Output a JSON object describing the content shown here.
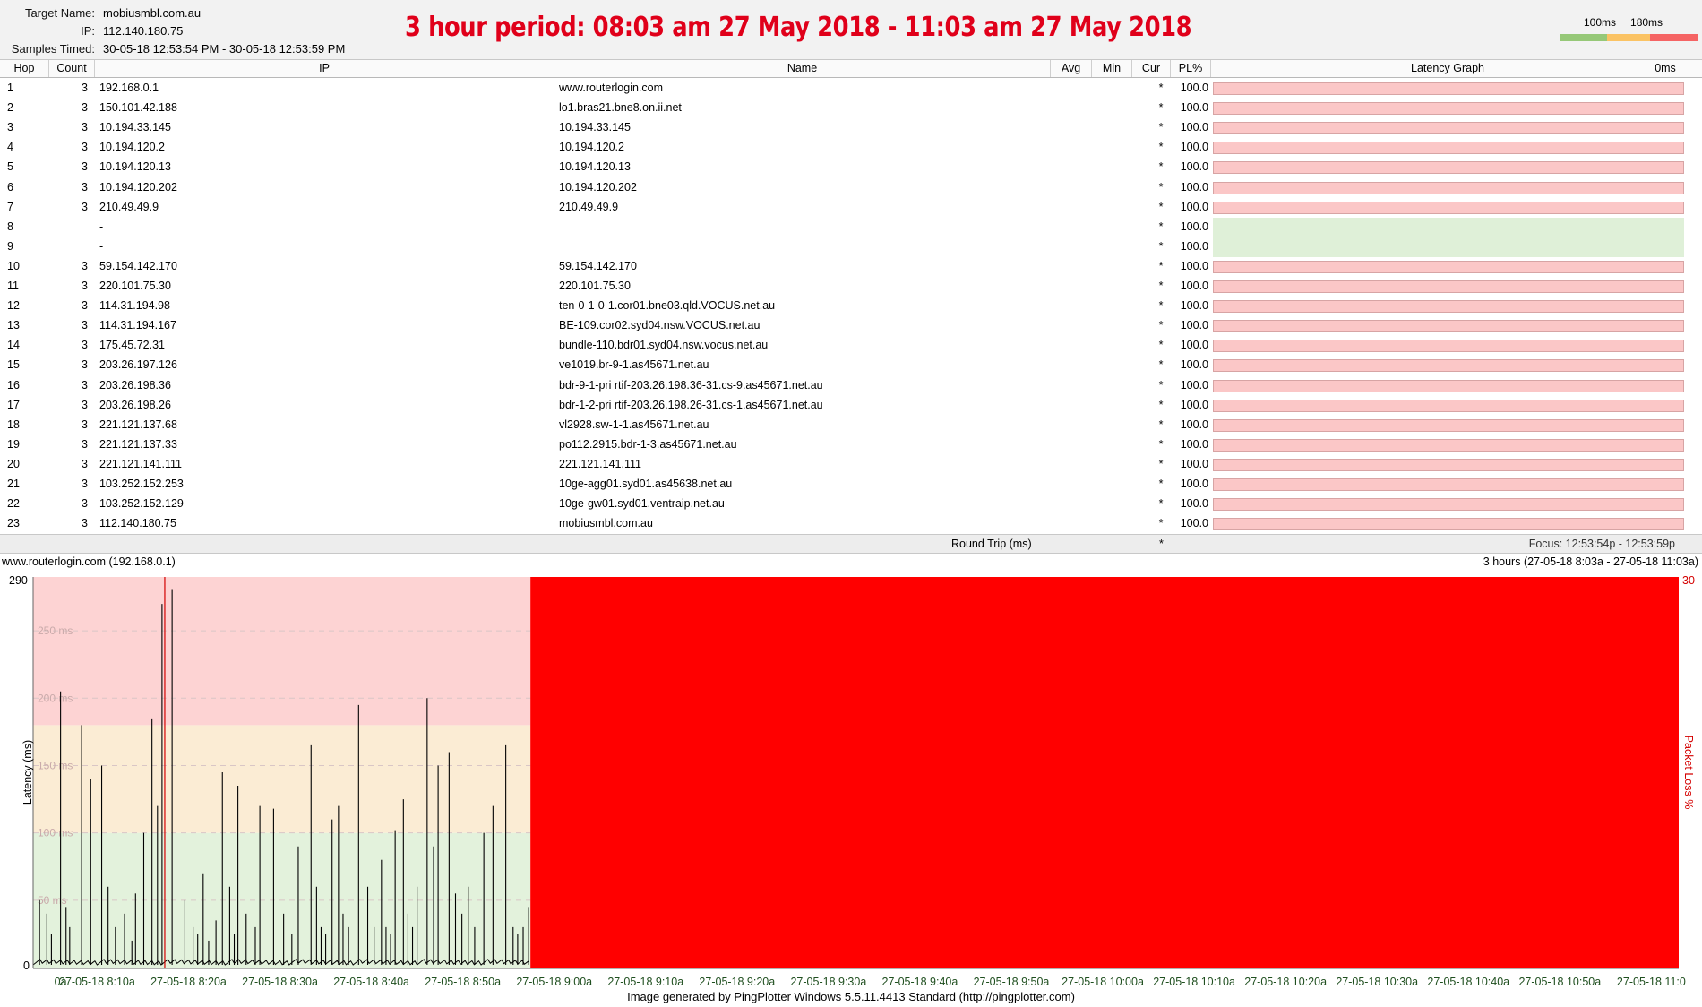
{
  "colors": {
    "accent_red": "#e0001a",
    "loss_fill": "#ff0000",
    "zone_good": "#e3f2dc",
    "zone_warn": "#fbecd4",
    "zone_bad": "#fdd3d3",
    "row_loss": "#fbc7c7",
    "row_empty": "#dff0d8",
    "legend_green": "#96c878",
    "legend_yellow": "#fbc364",
    "legend_red": "#f56464",
    "row_alt_bg": "#ffffff"
  },
  "header": {
    "target_label": "Target Name:",
    "target_value": "mobiusmbl.com.au",
    "ip_label": "IP:",
    "ip_value": "112.140.180.75",
    "samples_label": "Samples Timed:",
    "samples_value": "30-05-18 12:53:54 PM - 30-05-18 12:53:59 PM",
    "period_title": "3 hour period:  08:03 am 27 May 2018 - 11:03 am 27 May 2018",
    "legend_low": "100ms",
    "legend_high": "180ms"
  },
  "table": {
    "columns": [
      "Hop",
      "Count",
      "IP",
      "Name",
      "Avg",
      "Min",
      "Cur",
      "PL%",
      "Latency Graph",
      "0ms"
    ],
    "rows": [
      {
        "hop": "1",
        "count": "3",
        "ip": "192.168.0.1",
        "name": "www.routerlogin.com",
        "cur": "*",
        "pl": "100.0",
        "state": "loss"
      },
      {
        "hop": "2",
        "count": "3",
        "ip": "150.101.42.188",
        "name": "lo1.bras21.bne8.on.ii.net",
        "cur": "*",
        "pl": "100.0",
        "state": "loss"
      },
      {
        "hop": "3",
        "count": "3",
        "ip": "10.194.33.145",
        "name": "10.194.33.145",
        "cur": "*",
        "pl": "100.0",
        "state": "loss"
      },
      {
        "hop": "4",
        "count": "3",
        "ip": "10.194.120.2",
        "name": "10.194.120.2",
        "cur": "*",
        "pl": "100.0",
        "state": "loss"
      },
      {
        "hop": "5",
        "count": "3",
        "ip": "10.194.120.13",
        "name": "10.194.120.13",
        "cur": "*",
        "pl": "100.0",
        "state": "loss"
      },
      {
        "hop": "6",
        "count": "3",
        "ip": "10.194.120.202",
        "name": "10.194.120.202",
        "cur": "*",
        "pl": "100.0",
        "state": "loss"
      },
      {
        "hop": "7",
        "count": "3",
        "ip": "210.49.49.9",
        "name": "210.49.49.9",
        "cur": "*",
        "pl": "100.0",
        "state": "loss"
      },
      {
        "hop": "8",
        "count": "",
        "ip": "-",
        "name": "",
        "cur": "*",
        "pl": "100.0",
        "state": "empty"
      },
      {
        "hop": "9",
        "count": "",
        "ip": "-",
        "name": "",
        "cur": "*",
        "pl": "100.0",
        "state": "empty"
      },
      {
        "hop": "10",
        "count": "3",
        "ip": "59.154.142.170",
        "name": "59.154.142.170",
        "cur": "*",
        "pl": "100.0",
        "state": "loss"
      },
      {
        "hop": "11",
        "count": "3",
        "ip": "220.101.75.30",
        "name": "220.101.75.30",
        "cur": "*",
        "pl": "100.0",
        "state": "loss"
      },
      {
        "hop": "12",
        "count": "3",
        "ip": "114.31.194.98",
        "name": "ten-0-1-0-1.cor01.bne03.qld.VOCUS.net.au",
        "cur": "*",
        "pl": "100.0",
        "state": "loss"
      },
      {
        "hop": "13",
        "count": "3",
        "ip": "114.31.194.167",
        "name": "BE-109.cor02.syd04.nsw.VOCUS.net.au",
        "cur": "*",
        "pl": "100.0",
        "state": "loss"
      },
      {
        "hop": "14",
        "count": "3",
        "ip": "175.45.72.31",
        "name": "bundle-110.bdr01.syd04.nsw.vocus.net.au",
        "cur": "*",
        "pl": "100.0",
        "state": "loss"
      },
      {
        "hop": "15",
        "count": "3",
        "ip": "203.26.197.126",
        "name": "ve1019.br-9-1.as45671.net.au",
        "cur": "*",
        "pl": "100.0",
        "state": "loss"
      },
      {
        "hop": "16",
        "count": "3",
        "ip": "203.26.198.36",
        "name": "bdr-9-1-pri rtif-203.26.198.36-31.cs-9.as45671.net.au",
        "cur": "*",
        "pl": "100.0",
        "state": "loss"
      },
      {
        "hop": "17",
        "count": "3",
        "ip": "203.26.198.26",
        "name": "bdr-1-2-pri rtif-203.26.198.26-31.cs-1.as45671.net.au",
        "cur": "*",
        "pl": "100.0",
        "state": "loss"
      },
      {
        "hop": "18",
        "count": "3",
        "ip": "221.121.137.68",
        "name": "vl2928.sw-1-1.as45671.net.au",
        "cur": "*",
        "pl": "100.0",
        "state": "loss"
      },
      {
        "hop": "19",
        "count": "3",
        "ip": "221.121.137.33",
        "name": "po112.2915.bdr-1-3.as45671.net.au",
        "cur": "*",
        "pl": "100.0",
        "state": "loss"
      },
      {
        "hop": "20",
        "count": "3",
        "ip": "221.121.141.111",
        "name": "221.121.141.111",
        "cur": "*",
        "pl": "100.0",
        "state": "loss"
      },
      {
        "hop": "21",
        "count": "3",
        "ip": "103.252.152.253",
        "name": "10ge-agg01.syd01.as45638.net.au",
        "cur": "*",
        "pl": "100.0",
        "state": "loss"
      },
      {
        "hop": "22",
        "count": "3",
        "ip": "103.252.152.129",
        "name": "10ge-gw01.syd01.ventraip.net.au",
        "cur": "*",
        "pl": "100.0",
        "state": "loss"
      },
      {
        "hop": "23",
        "count": "3",
        "ip": "112.140.180.75",
        "name": "mobiusmbl.com.au",
        "cur": "*",
        "pl": "100.0",
        "state": "loss"
      }
    ],
    "roundtrip_label": "Round Trip (ms)",
    "roundtrip_cur": "*",
    "focus_label": "Focus: 12:53:54p - 12:53:59p"
  },
  "chart": {
    "title": "www.routerlogin.com (192.168.0.1)",
    "range_label": "3 hours (27-05-18 8:03a - 27-05-18 11:03a)"
  },
  "chart_data": {
    "type": "line",
    "ylabel": "Latency (ms)",
    "y2label": "Packet Loss %",
    "ylim": [
      0,
      290
    ],
    "y_top_label": "290",
    "y_bottom_label": "0",
    "y2_top_label": "30",
    "gridlines": [
      "250 ms",
      "200 ms",
      "150 ms",
      "100 ms",
      "50 ms"
    ],
    "gridline_values": [
      250,
      200,
      150,
      100,
      50
    ],
    "zones": [
      {
        "name": "good",
        "from": 0,
        "to": 100
      },
      {
        "name": "warn",
        "from": 100,
        "to": 180
      },
      {
        "name": "bad",
        "from": 180,
        "to": 290
      }
    ],
    "x_range_minutes": [
      0,
      180
    ],
    "x_ticks": [
      "0a",
      "27-05-18 8:10a",
      "27-05-18 8:20a",
      "27-05-18 8:30a",
      "27-05-18 8:40a",
      "27-05-18 8:50a",
      "27-05-18 9:00a",
      "27-05-18 9:10a",
      "27-05-18 9:20a",
      "27-05-18 9:30a",
      "27-05-18 9:40a",
      "27-05-18 9:50a",
      "27-05-18 10:00a",
      "27-05-18 10:10a",
      "27-05-18 10:20a",
      "27-05-18 10:30a",
      "27-05-18 10:40a",
      "27-05-18 10:50a",
      "27-05-18 11:0"
    ],
    "x_tick_minutes": [
      3,
      7,
      17,
      27,
      37,
      47,
      57,
      67,
      77,
      87,
      97,
      107,
      117,
      127,
      137,
      147,
      157,
      167,
      177
    ],
    "loss_start_minute": 54.4,
    "marker_minute": 14.4,
    "spikes": [
      {
        "minute": 0.7,
        "ms": 50
      },
      {
        "minute": 1.5,
        "ms": 40
      },
      {
        "minute": 2.0,
        "ms": 25
      },
      {
        "minute": 3.0,
        "ms": 205
      },
      {
        "minute": 3.6,
        "ms": 45
      },
      {
        "minute": 4.0,
        "ms": 30
      },
      {
        "minute": 5.3,
        "ms": 180
      },
      {
        "minute": 6.3,
        "ms": 140
      },
      {
        "minute": 7.5,
        "ms": 150
      },
      {
        "minute": 8.2,
        "ms": 60
      },
      {
        "minute": 9.0,
        "ms": 30
      },
      {
        "minute": 10.0,
        "ms": 40
      },
      {
        "minute": 10.8,
        "ms": 20
      },
      {
        "minute": 11.2,
        "ms": 55
      },
      {
        "minute": 12.1,
        "ms": 100
      },
      {
        "minute": 13.0,
        "ms": 185
      },
      {
        "minute": 13.6,
        "ms": 120
      },
      {
        "minute": 14.1,
        "ms": 270
      },
      {
        "minute": 15.2,
        "ms": 281
      },
      {
        "minute": 16.6,
        "ms": 50
      },
      {
        "minute": 17.5,
        "ms": 30
      },
      {
        "minute": 18.0,
        "ms": 25
      },
      {
        "minute": 18.6,
        "ms": 70
      },
      {
        "minute": 19.2,
        "ms": 20
      },
      {
        "minute": 20.0,
        "ms": 35
      },
      {
        "minute": 20.7,
        "ms": 145
      },
      {
        "minute": 21.5,
        "ms": 60
      },
      {
        "minute": 22.0,
        "ms": 25
      },
      {
        "minute": 22.4,
        "ms": 135
      },
      {
        "minute": 23.3,
        "ms": 40
      },
      {
        "minute": 24.3,
        "ms": 30
      },
      {
        "minute": 24.8,
        "ms": 120
      },
      {
        "minute": 26.3,
        "ms": 118
      },
      {
        "minute": 27.4,
        "ms": 40
      },
      {
        "minute": 28.3,
        "ms": 25
      },
      {
        "minute": 29.0,
        "ms": 90
      },
      {
        "minute": 30.4,
        "ms": 165
      },
      {
        "minute": 31.0,
        "ms": 60
      },
      {
        "minute": 31.5,
        "ms": 30
      },
      {
        "minute": 32.0,
        "ms": 25
      },
      {
        "minute": 32.7,
        "ms": 110
      },
      {
        "minute": 33.4,
        "ms": 120
      },
      {
        "minute": 33.9,
        "ms": 40
      },
      {
        "minute": 34.5,
        "ms": 30
      },
      {
        "minute": 35.6,
        "ms": 195
      },
      {
        "minute": 36.6,
        "ms": 60
      },
      {
        "minute": 37.3,
        "ms": 30
      },
      {
        "minute": 38.1,
        "ms": 80
      },
      {
        "minute": 38.6,
        "ms": 30
      },
      {
        "minute": 39.1,
        "ms": 25
      },
      {
        "minute": 39.6,
        "ms": 102
      },
      {
        "minute": 40.5,
        "ms": 125
      },
      {
        "minute": 41.0,
        "ms": 40
      },
      {
        "minute": 41.5,
        "ms": 30
      },
      {
        "minute": 42.0,
        "ms": 60
      },
      {
        "minute": 43.1,
        "ms": 200
      },
      {
        "minute": 43.8,
        "ms": 90
      },
      {
        "minute": 44.3,
        "ms": 150
      },
      {
        "minute": 45.5,
        "ms": 160
      },
      {
        "minute": 46.2,
        "ms": 55
      },
      {
        "minute": 46.9,
        "ms": 40
      },
      {
        "minute": 47.6,
        "ms": 60
      },
      {
        "minute": 48.3,
        "ms": 30
      },
      {
        "minute": 49.3,
        "ms": 100
      },
      {
        "minute": 50.3,
        "ms": 120
      },
      {
        "minute": 51.7,
        "ms": 165
      },
      {
        "minute": 52.5,
        "ms": 30
      },
      {
        "minute": 53.0,
        "ms": 25
      },
      {
        "minute": 53.6,
        "ms": 30
      },
      {
        "minute": 54.2,
        "ms": 45
      }
    ]
  },
  "footer": {
    "text": "Image generated by PingPlotter Windows 5.5.11.4413 Standard (http://pingplotter.com)"
  }
}
